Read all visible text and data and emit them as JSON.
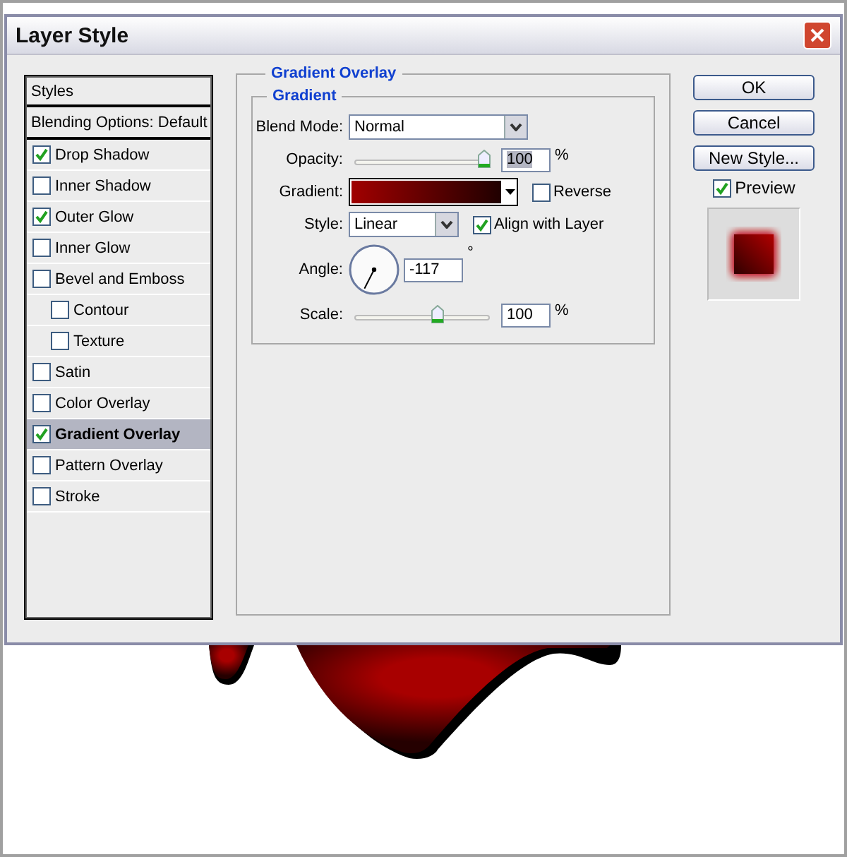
{
  "window": {
    "title": "Layer Style"
  },
  "styles_panel": {
    "header": "Styles",
    "blending_options": "Blending Options: Default",
    "items": [
      {
        "label": "Drop Shadow",
        "checked": true,
        "selected": false
      },
      {
        "label": "Inner Shadow",
        "checked": false,
        "selected": false
      },
      {
        "label": "Outer Glow",
        "checked": true,
        "selected": false
      },
      {
        "label": "Inner Glow",
        "checked": false,
        "selected": false
      },
      {
        "label": "Bevel and Emboss",
        "checked": false,
        "selected": false,
        "children": [
          {
            "label": "Contour",
            "checked": false,
            "selected": false
          },
          {
            "label": "Texture",
            "checked": false,
            "selected": false
          }
        ]
      },
      {
        "label": "Satin",
        "checked": false,
        "selected": false
      },
      {
        "label": "Color Overlay",
        "checked": false,
        "selected": false
      },
      {
        "label": "Gradient Overlay",
        "checked": true,
        "selected": true
      },
      {
        "label": "Pattern Overlay",
        "checked": false,
        "selected": false
      },
      {
        "label": "Stroke",
        "checked": false,
        "selected": false
      }
    ]
  },
  "panel": {
    "title": "Gradient Overlay",
    "group_title": "Gradient",
    "blend_mode": {
      "label": "Blend Mode:",
      "value": "Normal"
    },
    "opacity": {
      "label": "Opacity:",
      "level": 0.99,
      "value": "100",
      "unit": "%"
    },
    "gradient": {
      "label": "Gradient:",
      "reverse": {
        "label": "Reverse",
        "checked": false
      }
    },
    "style": {
      "label": "Style:",
      "value": "Linear",
      "align_with_layer": {
        "label": "Align with Layer",
        "checked": true
      }
    },
    "angle": {
      "label": "Angle:",
      "value": "-117",
      "unit": "°"
    },
    "scale": {
      "label": "Scale:",
      "level": 0.62,
      "value": "100",
      "unit": "%"
    }
  },
  "buttons": [
    "OK",
    "Cancel",
    "New Style..."
  ],
  "preview": {
    "label": "Preview",
    "checked": true
  }
}
